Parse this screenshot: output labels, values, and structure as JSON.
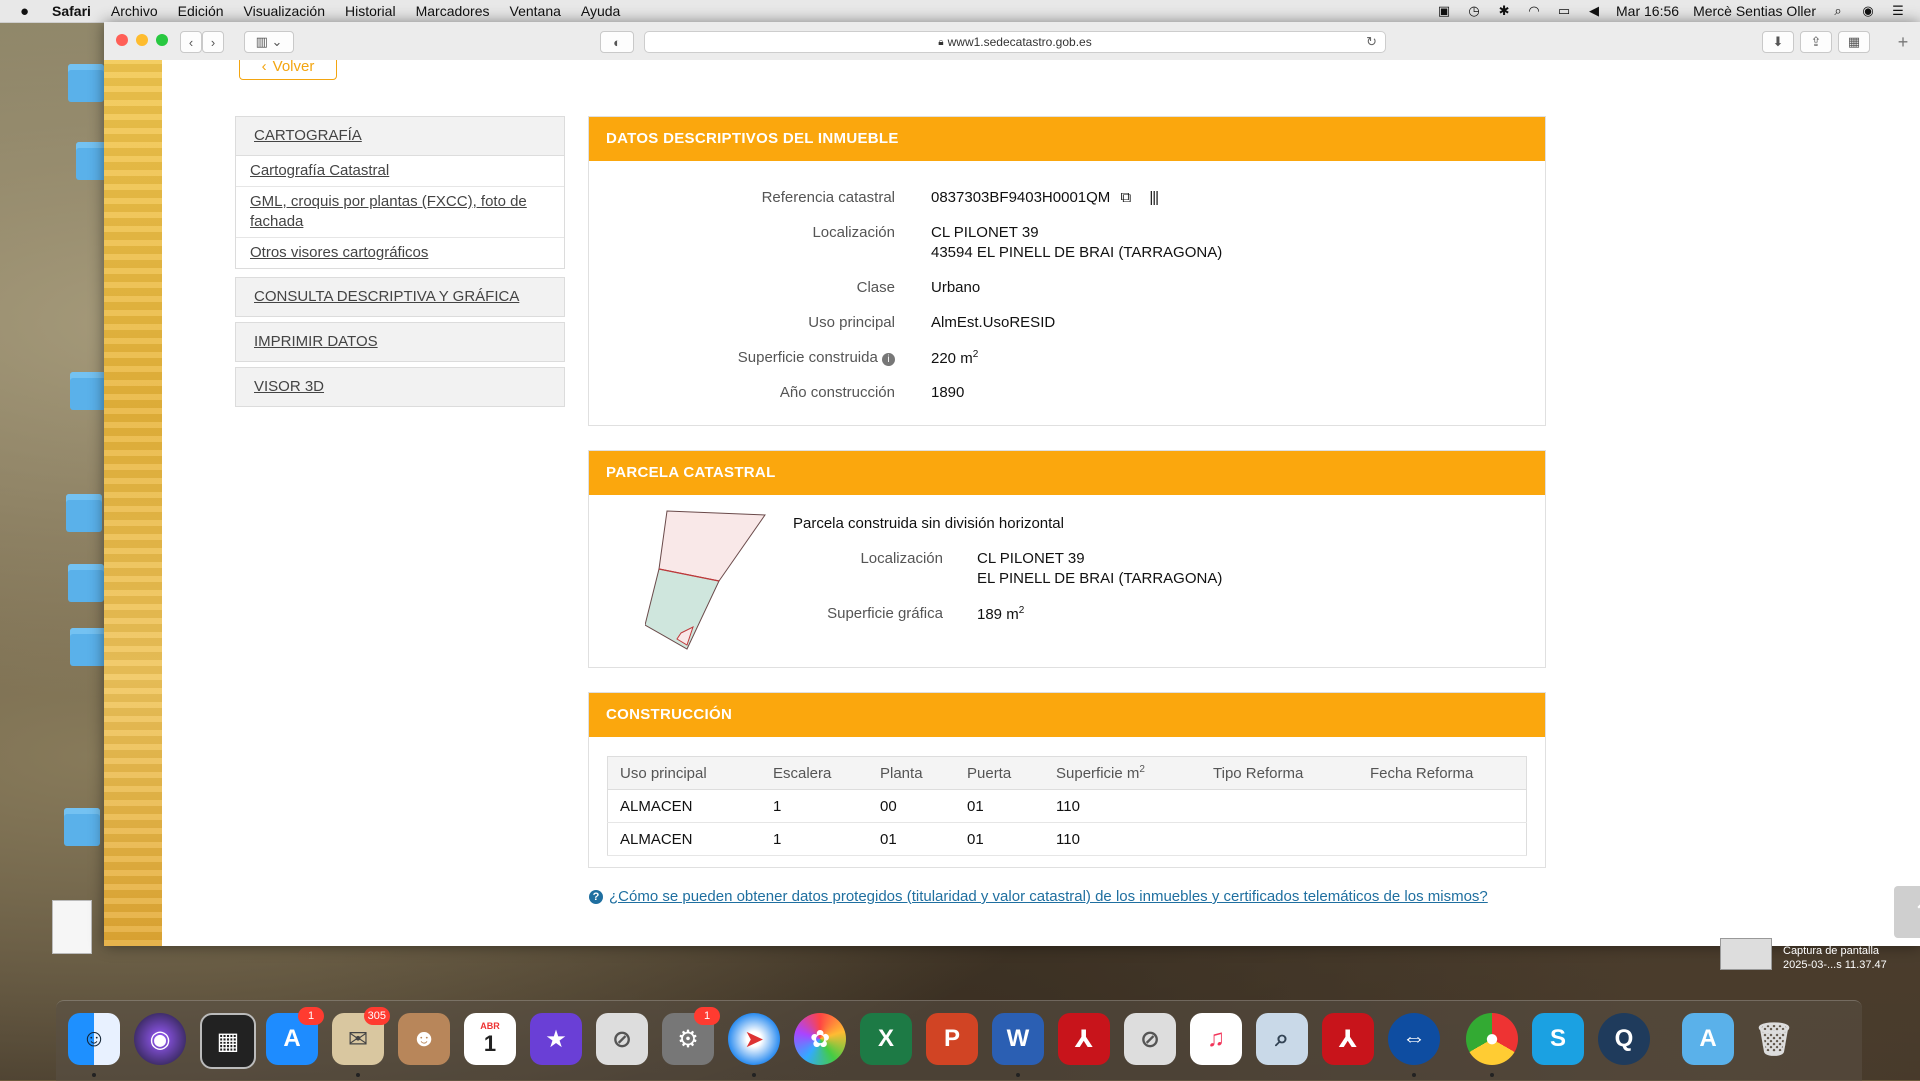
{
  "menubar": {
    "app": "Safari",
    "items": [
      "Archivo",
      "Edición",
      "Visualización",
      "Historial",
      "Marcadores",
      "Ventana",
      "Ayuda"
    ],
    "clock": "Mar 16:56",
    "user": "Mercè Sentias Oller"
  },
  "browser": {
    "url": "www1.sedecatastro.gob.es"
  },
  "sidebar": {
    "back_label": "Volver",
    "cartografia": {
      "title": "CARTOGRAFÍA",
      "items": [
        "Cartografía Catastral",
        "GML, croquis por plantas (FXCC), foto de fachada",
        "Otros visores cartográficos"
      ]
    },
    "consulta": "CONSULTA DESCRIPTIVA Y GRÁFICA",
    "imprimir": "IMPRIMIR DATOS",
    "visor": "VISOR 3D"
  },
  "datos": {
    "title": "DATOS DESCRIPTIVOS DEL INMUEBLE",
    "labels": {
      "referencia": "Referencia catastral",
      "localizacion": "Localización",
      "clase": "Clase",
      "uso": "Uso principal",
      "superficie": "Superficie construida",
      "anio": "Año construcción"
    },
    "referencia": "0837303BF9403H0001QM",
    "localizacion_1": "CL PILONET 39",
    "localizacion_2": "43594 EL PINELL DE BRAI (TARRAGONA)",
    "clase": "Urbano",
    "uso": "AlmEst.UsoRESID",
    "superficie": "220 m",
    "superficie_unit_sup": "2",
    "anio": "1890"
  },
  "parcela": {
    "title": "PARCELA CATASTRAL",
    "descripcion": "Parcela construida sin división horizontal",
    "label_localizacion": "Localización",
    "localizacion_1": "CL PILONET 39",
    "localizacion_2": "EL PINELL DE BRAI (TARRAGONA)",
    "label_superficie": "Superficie gráfica",
    "superficie": "189 m",
    "superficie_unit_sup": "2"
  },
  "construccion": {
    "title": "CONSTRUCCIÓN",
    "columns": [
      "Uso principal",
      "Escalera",
      "Planta",
      "Puerta",
      "Superficie m",
      "Tipo Reforma",
      "Fecha Reforma"
    ],
    "superficie_col_sup": "2",
    "rows": [
      [
        "ALMACEN",
        "1",
        "00",
        "01",
        "110",
        "",
        ""
      ],
      [
        "ALMACEN",
        "1",
        "01",
        "01",
        "110",
        "",
        ""
      ]
    ]
  },
  "help_link": "¿Cómo se pueden obtener datos protegidos (titularidad y valor catastral) de los inmuebles y certificados telemáticos de los mismos?",
  "desktop": {
    "screenshot_label_1": "Captura de pantalla",
    "screenshot_label_2": "2025-03-...s 11.37.47"
  },
  "dock": {
    "appstore_badge": "1",
    "mail_badge": "305",
    "calendar_month": "ABR",
    "calendar_day": "1",
    "prefs_badge": "1"
  }
}
